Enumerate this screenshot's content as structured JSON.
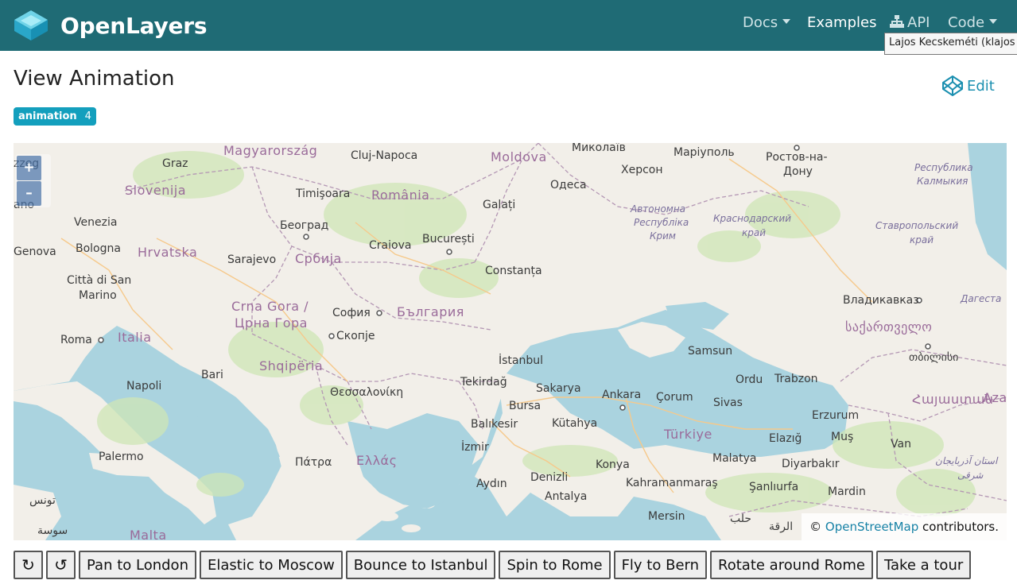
{
  "navbar": {
    "brand": "OpenLayers",
    "links": {
      "docs": "Docs",
      "examples": "Examples",
      "api": "API",
      "code": "Code"
    },
    "tooltip": "Lajos Kecskeméti (klajos"
  },
  "page": {
    "title": "View Animation",
    "edit_label": "Edit",
    "tag": {
      "name": "animation",
      "count": "4"
    }
  },
  "map": {
    "zoom_in": "+",
    "zoom_out": "–",
    "attribution_prefix": "©",
    "attribution_link": "OpenStreetMap",
    "attribution_suffix": "contributors.",
    "labels": {
      "magyarorszag": "Magyarország",
      "cluj": "Cluj-Napoca",
      "moldova": "Moldova",
      "mykolaiv": "Миколаїв",
      "mariupol": "Маріуполь",
      "rostov": "Ростов-на-",
      "donu": "Дону",
      "kalmykia1": "Республика",
      "kalmykia2": "Калмыкия",
      "graz": "Graz",
      "kherson": "Херсон",
      "slovenija": "Slovenija",
      "timisoara": "Timişoara",
      "romania": "România",
      "odesa": "Одеса",
      "galati": "Galați",
      "crimea1": "Автономна",
      "crimea2": "Республіка",
      "crimea3": "Крим",
      "krasnodar1": "Краснодарский",
      "krasnodar2": "край",
      "stavropol1": "Ставропольский",
      "stavropol2": "край",
      "venezia": "Venezia",
      "beograd": "Београд",
      "bucuresti": "București",
      "genova": "Genova",
      "bologna": "Bologna",
      "hrvatska": "Hrvatska",
      "sarajevo": "Sarajevo",
      "srbija": "Србија",
      "craiova": "Craiova",
      "constanta": "Constanța",
      "sanmarino1": "Città di San",
      "sanmarino2": "Marino",
      "crnagora1": "Crna Gora /",
      "crnagora2": "Црна Гора",
      "sofia": "София",
      "bulgaria": "България",
      "vladikavkaz": "Владикавказ",
      "dagestan": "Дагеста",
      "roma": "Roma",
      "italia": "Italia",
      "skopje": "Скопје",
      "georgia": "საქართველო",
      "tbilisi": "თბილისი",
      "shqiperia": "Shqipëria",
      "istanbul": "İstanbul",
      "samsun": "Samsun",
      "bari": "Bari",
      "tekirdag": "Tekirdağ",
      "ordu": "Ordu",
      "trabzon": "Trabzon",
      "napoli": "Napoli",
      "thessaloniki": "Θεσσαλονίκη",
      "sakarya": "Sakarya",
      "ankara": "Ankara",
      "corum": "Çorum",
      "bursa": "Bursa",
      "sivas": "Sivas",
      "aza": "Aza",
      "armenia": "Հայաստան",
      "balikesir": "Balıkesir",
      "kutahya": "Kütahya",
      "erzurum": "Erzurum",
      "turkiye": "Türkiye",
      "elazig": "Elazığ",
      "mus": "Muş",
      "izmir": "İzmir",
      "palermo": "Palermo",
      "patra": "Πάτρα",
      "ellas": "Ελλάς",
      "konya": "Konya",
      "malatya": "Malatya",
      "diyarbakir": "Diyarbakır",
      "van": "Van",
      "azarbaijan1": "استان آذربایجان",
      "azarbaijan2": "شرقی",
      "aydin": "Aydın",
      "denizli": "Denizli",
      "kahramanmaras": "Kahramanmaraş",
      "sanliurfa": "Şanlıurfa",
      "tunis": "تونس",
      "antalya": "Antalya",
      "mardin": "Mardin",
      "mersin": "Mersin",
      "halab": "حلب",
      "raqqa": "الرقة",
      "sousse": "سوسة",
      "malta": "Malta",
      "zzeg": "zzeg",
      "ano": "ano"
    }
  },
  "buttons": {
    "rotate_left": "↻",
    "rotate_right": "↺",
    "pan_london": "Pan to London",
    "elastic_moscow": "Elastic to Moscow",
    "bounce_istanbul": "Bounce to Istanbul",
    "spin_rome": "Spin to Rome",
    "fly_bern": "Fly to Bern",
    "rotate_rome": "Rotate around Rome",
    "tour": "Take a tour"
  },
  "colors": {
    "navbar": "#1f6b75",
    "sea": "#aad3df",
    "land": "#f2efe9",
    "tag": "#139fbd",
    "link": "#1782a6"
  }
}
